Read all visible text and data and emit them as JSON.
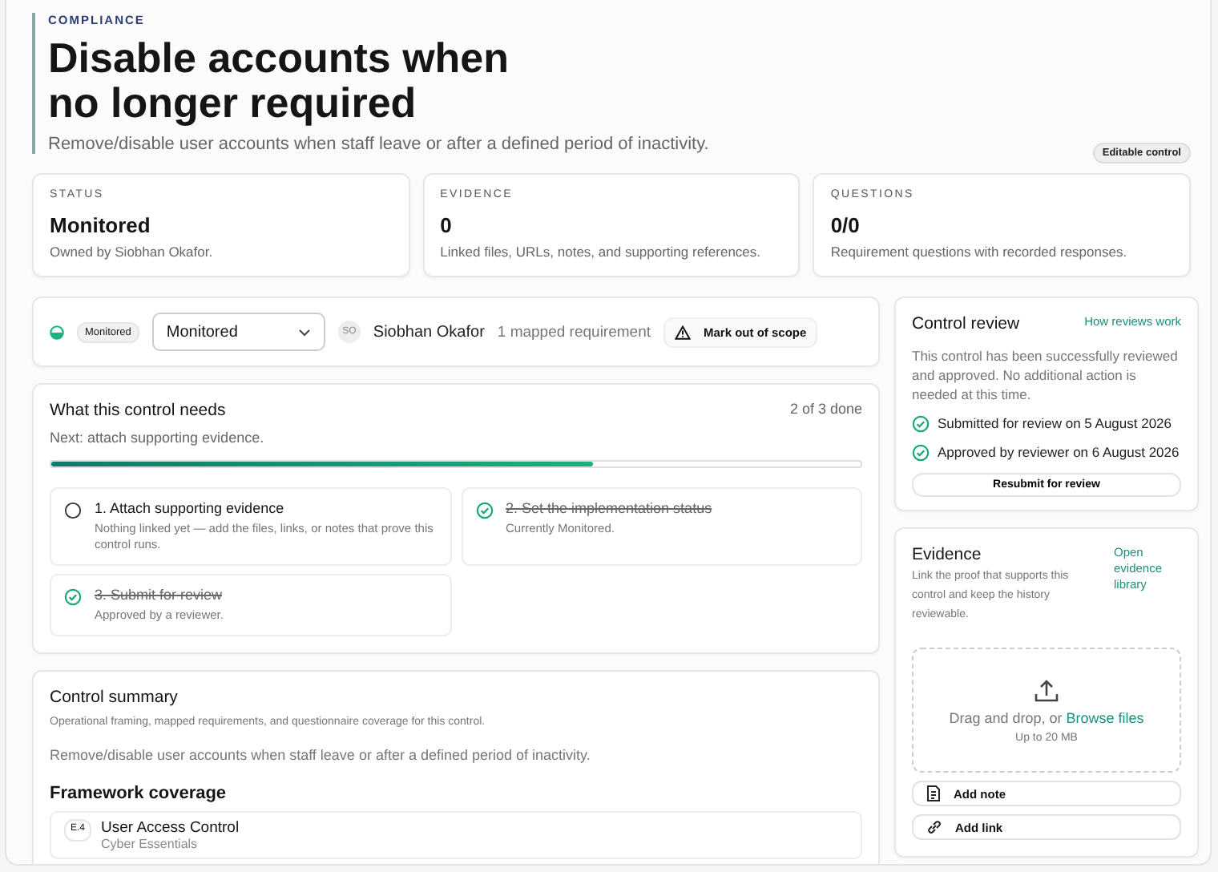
{
  "header": {
    "eyebrow": "COMPLIANCE",
    "title": "Disable accounts when no longer required",
    "description": "Remove/disable user accounts when staff leave or after a defined period of inactivity.",
    "badge": "Editable control"
  },
  "stats": [
    {
      "label": "STATUS",
      "value": "Monitored",
      "note": "Owned by Siobhan Okafor."
    },
    {
      "label": "EVIDENCE",
      "value": "0",
      "note": "Linked files, URLs, notes, and supporting references."
    },
    {
      "label": "QUESTIONS",
      "value": "0/0",
      "note": "Requirement questions with recorded responses."
    }
  ],
  "toolbar": {
    "status_badge": "Monitored",
    "status_select": "Monitored",
    "owner_initials": "SO",
    "owner": "Siobhan Okafor",
    "mapped": "1 mapped requirement",
    "scope_button": "Mark out of scope"
  },
  "needs": {
    "title": "What this control needs",
    "progress_text": "2 of 3 done",
    "next": "Next: attach supporting evidence.",
    "level": 0.67,
    "steps": [
      {
        "title": "1. Attach supporting evidence",
        "note": "Nothing linked yet — add the files, links, or notes that prove this control runs.",
        "done": false
      },
      {
        "title": "2. Set the implementation status",
        "note": "Currently Monitored.",
        "done": true
      },
      {
        "title": "3. Submit for review",
        "note": "Approved by a reviewer.",
        "done": true
      }
    ]
  },
  "summary": {
    "title": "Control summary",
    "subtitle": "Operational framing, mapped requirements, and questionnaire coverage for this control.",
    "description": "Remove/disable user accounts when staff leave or after a defined period of inactivity.",
    "coverage_title": "Framework coverage",
    "frameworks": [
      {
        "code": "E.4",
        "name": "User Access Control",
        "framework": "Cyber Essentials"
      }
    ]
  },
  "review": {
    "title": "Control review",
    "link": "How reviews work",
    "text": "This control has been successfully reviewed and approved. No additional action is needed at this time.",
    "history": [
      "Submitted for review on 5 August 2026",
      "Approved by reviewer on 6 August 2026"
    ],
    "button": "Resubmit for review"
  },
  "evidence": {
    "title": "Evidence",
    "link": "Open evidence library",
    "text": "Link the proof that supports this control and keep the history reviewable.",
    "drop_text": "Drag and drop, or",
    "browse": "Browse files",
    "limit": "Up to 20 MB",
    "actions": [
      {
        "kind": "note",
        "label": "Add note"
      },
      {
        "kind": "link",
        "label": "Add link"
      }
    ]
  }
}
